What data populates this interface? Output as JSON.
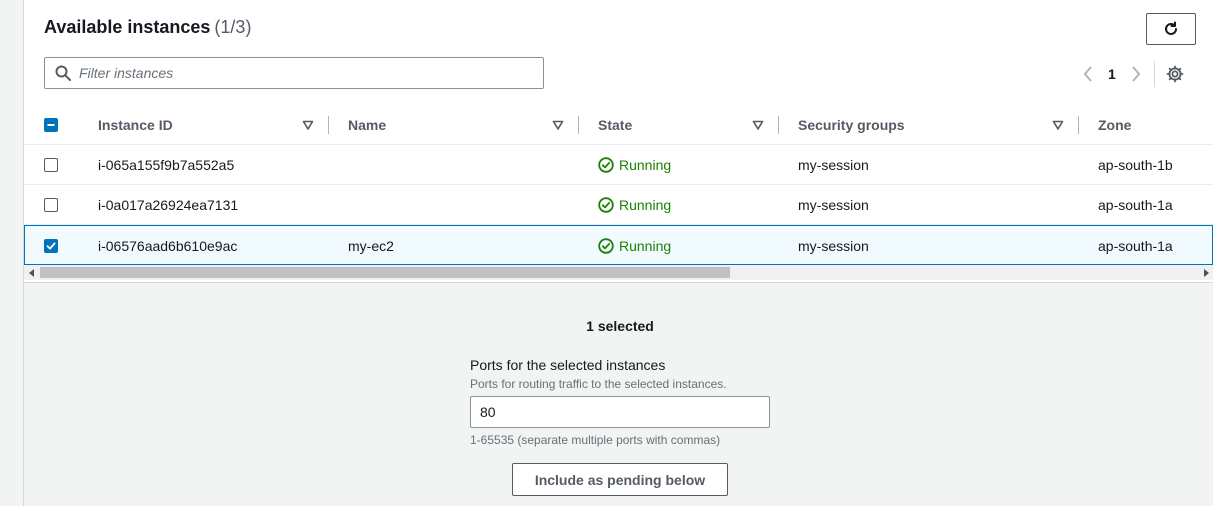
{
  "header": {
    "title": "Available instances",
    "count": "(1/3)"
  },
  "filter": {
    "placeholder": "Filter instances",
    "value": ""
  },
  "pagination": {
    "current_page": "1"
  },
  "table": {
    "columns": [
      "Instance ID",
      "Name",
      "State",
      "Security groups",
      "Zone"
    ],
    "rows": [
      {
        "id": "i-065a155f9b7a552a5",
        "name": "",
        "state": "Running",
        "security_group": "my-session",
        "zone": "ap-south-1b",
        "selected": false
      },
      {
        "id": "i-0a017a26924ea7131",
        "name": "",
        "state": "Running",
        "security_group": "my-session",
        "zone": "ap-south-1a",
        "selected": false
      },
      {
        "id": "i-06576aad6b610e9ac",
        "name": "my-ec2",
        "state": "Running",
        "security_group": "my-session",
        "zone": "ap-south-1a",
        "selected": true
      }
    ]
  },
  "selection": {
    "summary": "1 selected"
  },
  "ports": {
    "label": "Ports for the selected instances",
    "description": "Ports for routing traffic to the selected instances.",
    "value": "80",
    "hint": "1-65535 (separate multiple ports with commas)"
  },
  "actions": {
    "include_pending_label": "Include as pending below"
  },
  "colors": {
    "accent": "#0073bb",
    "status_ok": "#1d8102",
    "selected_row_bg": "#f1faff"
  },
  "icons": {
    "refresh": "refresh-icon",
    "search": "search-icon",
    "settings": "gear-icon",
    "status": "check-circle-icon"
  }
}
